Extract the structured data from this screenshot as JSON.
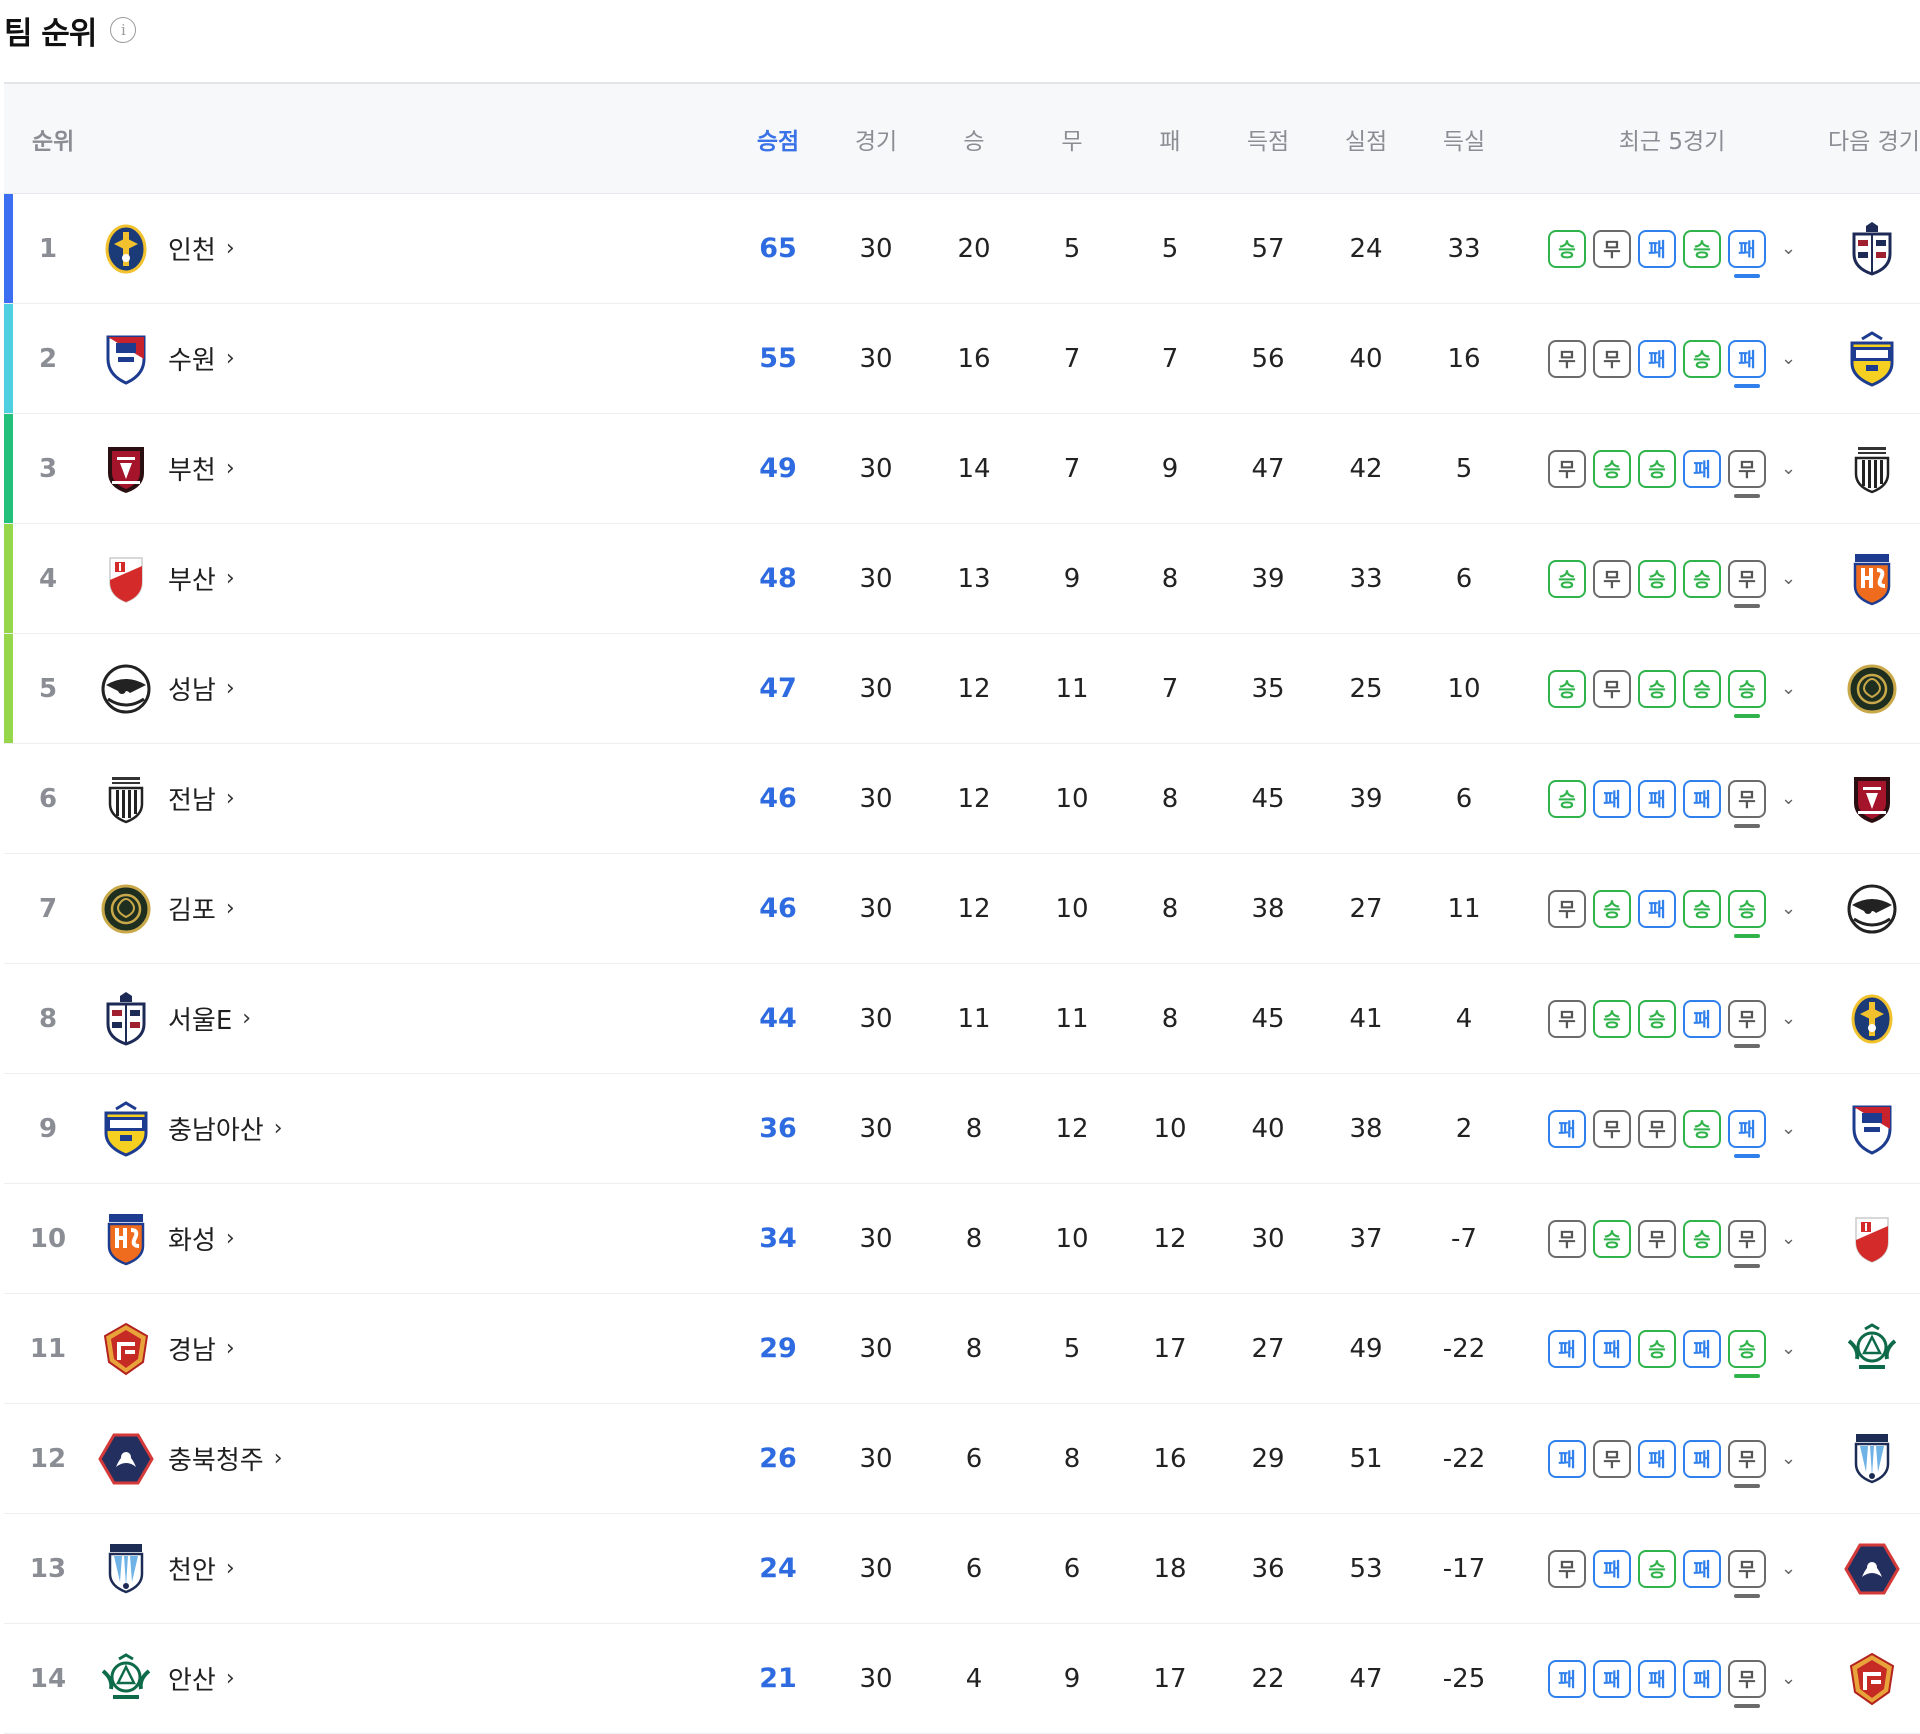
{
  "page": {
    "title": "팀 순위",
    "info_icon": "i"
  },
  "headers": {
    "rank": "순위",
    "points": "승점",
    "played": "경기",
    "won": "승",
    "drawn": "무",
    "lost": "패",
    "goals_for": "득점",
    "goals_against": "실점",
    "goal_diff": "득실",
    "recent": "최근 5경기",
    "next": "다음 경기"
  },
  "colors": {
    "accent_blue": "#2f6be0",
    "win_green": "#2fb34a",
    "loss_blue": "#2f80ed",
    "draw_gray": "#6b6b6b",
    "rank_bar_1": "#3b6ef0",
    "rank_bar_2": "#4fd0e0",
    "rank_bar_3": "#22c07a",
    "rank_bar_4_5": "#96d64a"
  },
  "chevron": "›",
  "dropdown": "⌄",
  "rows": [
    {
      "rank": "1",
      "team": "인천",
      "logo": "incheon-crest",
      "points": "65",
      "played": "30",
      "won": "20",
      "drawn": "5",
      "lost": "5",
      "gf": "57",
      "ga": "24",
      "gd": "33",
      "form": [
        "승",
        "무",
        "패",
        "승",
        "패"
      ],
      "next_logo": "seoul-e-crest"
    },
    {
      "rank": "2",
      "team": "수원",
      "logo": "suwon-crest",
      "points": "55",
      "played": "30",
      "won": "16",
      "drawn": "7",
      "lost": "7",
      "gf": "56",
      "ga": "40",
      "gd": "16",
      "form": [
        "무",
        "무",
        "패",
        "승",
        "패"
      ],
      "next_logo": "asan-crest"
    },
    {
      "rank": "3",
      "team": "부천",
      "logo": "bucheon-crest",
      "points": "49",
      "played": "30",
      "won": "14",
      "drawn": "7",
      "lost": "9",
      "gf": "47",
      "ga": "42",
      "gd": "5",
      "form": [
        "무",
        "승",
        "승",
        "패",
        "무"
      ],
      "next_logo": "jeonnam-crest"
    },
    {
      "rank": "4",
      "team": "부산",
      "logo": "busan-crest",
      "points": "48",
      "played": "30",
      "won": "13",
      "drawn": "9",
      "lost": "8",
      "gf": "39",
      "ga": "33",
      "gd": "6",
      "form": [
        "승",
        "무",
        "승",
        "승",
        "무"
      ],
      "next_logo": "hwaseong-crest"
    },
    {
      "rank": "5",
      "team": "성남",
      "logo": "seongnam-crest",
      "points": "47",
      "played": "30",
      "won": "12",
      "drawn": "11",
      "lost": "7",
      "gf": "35",
      "ga": "25",
      "gd": "10",
      "form": [
        "승",
        "무",
        "승",
        "승",
        "승"
      ],
      "next_logo": "gimpo-crest"
    },
    {
      "rank": "6",
      "team": "전남",
      "logo": "jeonnam-crest",
      "points": "46",
      "played": "30",
      "won": "12",
      "drawn": "10",
      "lost": "8",
      "gf": "45",
      "ga": "39",
      "gd": "6",
      "form": [
        "승",
        "패",
        "패",
        "패",
        "무"
      ],
      "next_logo": "bucheon-crest"
    },
    {
      "rank": "7",
      "team": "김포",
      "logo": "gimpo-crest",
      "points": "46",
      "played": "30",
      "won": "12",
      "drawn": "10",
      "lost": "8",
      "gf": "38",
      "ga": "27",
      "gd": "11",
      "form": [
        "무",
        "승",
        "패",
        "승",
        "승"
      ],
      "next_logo": "seongnam-crest"
    },
    {
      "rank": "8",
      "team": "서울E",
      "logo": "seoul-e-crest",
      "points": "44",
      "played": "30",
      "won": "11",
      "drawn": "11",
      "lost": "8",
      "gf": "45",
      "ga": "41",
      "gd": "4",
      "form": [
        "무",
        "승",
        "승",
        "패",
        "무"
      ],
      "next_logo": "incheon-crest"
    },
    {
      "rank": "9",
      "team": "충남아산",
      "logo": "asan-crest",
      "points": "36",
      "played": "30",
      "won": "8",
      "drawn": "12",
      "lost": "10",
      "gf": "40",
      "ga": "38",
      "gd": "2",
      "form": [
        "패",
        "무",
        "무",
        "승",
        "패"
      ],
      "next_logo": "suwon-crest"
    },
    {
      "rank": "10",
      "team": "화성",
      "logo": "hwaseong-crest",
      "points": "34",
      "played": "30",
      "won": "8",
      "drawn": "10",
      "lost": "12",
      "gf": "30",
      "ga": "37",
      "gd": "-7",
      "form": [
        "무",
        "승",
        "무",
        "승",
        "무"
      ],
      "next_logo": "busan-crest"
    },
    {
      "rank": "11",
      "team": "경남",
      "logo": "gyeongnam-crest",
      "points": "29",
      "played": "30",
      "won": "8",
      "drawn": "5",
      "lost": "17",
      "gf": "27",
      "ga": "49",
      "gd": "-22",
      "form": [
        "패",
        "패",
        "승",
        "패",
        "승"
      ],
      "next_logo": "ansan-crest"
    },
    {
      "rank": "12",
      "team": "충북청주",
      "logo": "cheongju-crest",
      "points": "26",
      "played": "30",
      "won": "6",
      "drawn": "8",
      "lost": "16",
      "gf": "29",
      "ga": "51",
      "gd": "-22",
      "form": [
        "패",
        "무",
        "패",
        "패",
        "무"
      ],
      "next_logo": "cheonan-crest"
    },
    {
      "rank": "13",
      "team": "천안",
      "logo": "cheonan-crest",
      "points": "24",
      "played": "30",
      "won": "6",
      "drawn": "6",
      "lost": "18",
      "gf": "36",
      "ga": "53",
      "gd": "-17",
      "form": [
        "무",
        "패",
        "승",
        "패",
        "무"
      ],
      "next_logo": "cheongju-crest"
    },
    {
      "rank": "14",
      "team": "안산",
      "logo": "ansan-crest",
      "points": "21",
      "played": "30",
      "won": "4",
      "drawn": "9",
      "lost": "17",
      "gf": "22",
      "ga": "47",
      "gd": "-25",
      "form": [
        "패",
        "패",
        "패",
        "패",
        "무"
      ],
      "next_logo": "gyeongnam-crest"
    }
  ]
}
